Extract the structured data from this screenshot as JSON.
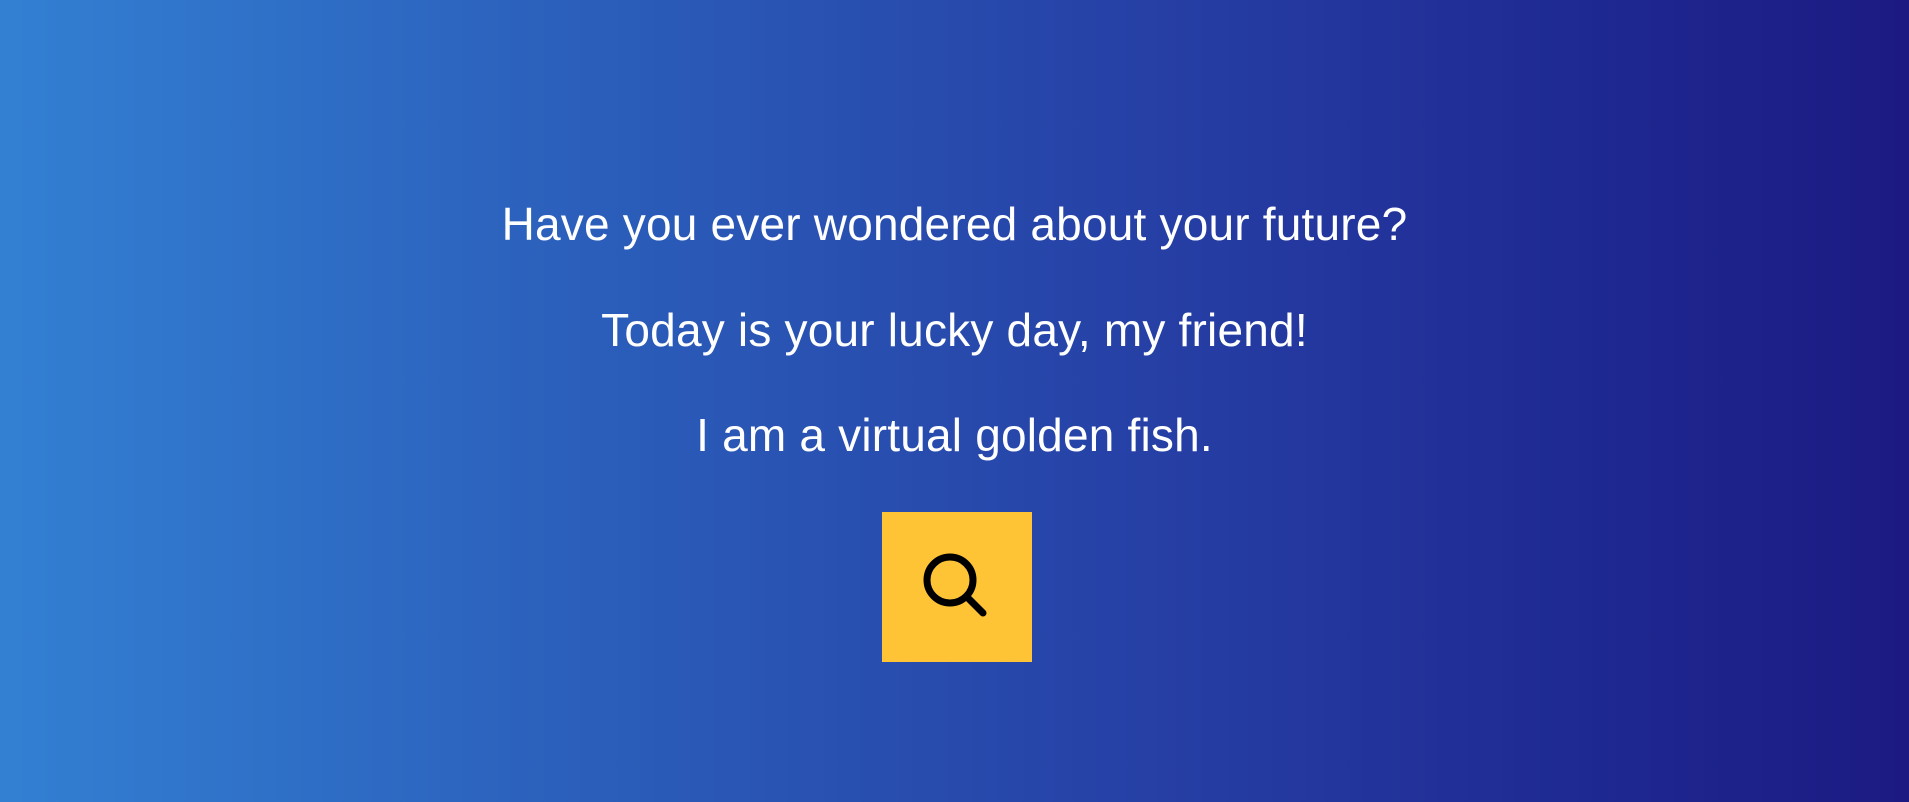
{
  "colors": {
    "background_start": "#3380D3",
    "background_end": "#1C1A82",
    "text": "#FFFFFF",
    "button_background": "#FFC436",
    "icon": "#000000"
  },
  "messages": [
    "Have you ever wondered about your future?",
    "Today is your lucky day, my friend!",
    "I am a virtual golden fish."
  ],
  "search_button": {
    "icon": "search-icon"
  }
}
